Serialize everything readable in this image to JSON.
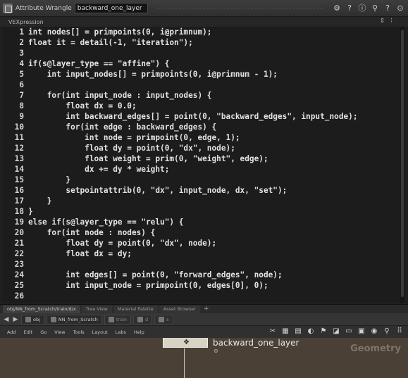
{
  "header": {
    "node_type": "Attribute Wrangle",
    "node_name": "backward_one_layer",
    "icons": [
      "gear-icon",
      "help-icon",
      "info-icon",
      "search-icon",
      "help-icon",
      "pin-icon"
    ]
  },
  "parameter": {
    "label": "VEXpression"
  },
  "code": {
    "lines": [
      {
        "n": "1",
        "text": "int nodes[] = primpoints(0, i@primnum);"
      },
      {
        "n": "2",
        "text": "float it = detail(-1, \"iteration\");"
      },
      {
        "n": "3",
        "text": ""
      },
      {
        "n": "4",
        "text": "if(s@layer_type == \"affine\") {"
      },
      {
        "n": "5",
        "text": "    int input_nodes[] = primpoints(0, i@primnum - 1);"
      },
      {
        "n": "6",
        "text": ""
      },
      {
        "n": "7",
        "text": "    for(int input_node : input_nodes) {"
      },
      {
        "n": "8",
        "text": "        float dx = 0.0;"
      },
      {
        "n": "9",
        "text": "        int backward_edges[] = point(0, \"backward_edges\", input_node);"
      },
      {
        "n": "10",
        "text": "        for(int edge : backward_edges) {"
      },
      {
        "n": "11",
        "text": "            int node = primpoint(0, edge, 1);"
      },
      {
        "n": "12",
        "text": "            float dy = point(0, \"dx\", node);"
      },
      {
        "n": "13",
        "text": "            float weight = prim(0, \"weight\", edge);"
      },
      {
        "n": "14",
        "text": "            dx += dy * weight;"
      },
      {
        "n": "15",
        "text": "        }"
      },
      {
        "n": "16",
        "text": "        setpointattrib(0, \"dx\", input_node, dx, \"set\");"
      },
      {
        "n": "17",
        "text": "    }"
      },
      {
        "n": "18",
        "text": "}"
      },
      {
        "n": "19",
        "text": "else if(s@layer_type == \"relu\") {"
      },
      {
        "n": "20",
        "text": "    for(int node : nodes) {"
      },
      {
        "n": "21",
        "text": "        float dy = point(0, \"dx\", node);"
      },
      {
        "n": "22",
        "text": "        float dx = dy;"
      },
      {
        "n": "23",
        "text": ""
      },
      {
        "n": "24",
        "text": "        int edges[] = point(0, \"forward_edges\", node);"
      },
      {
        "n": "25",
        "text": "        int input_node = primpoint(0, edges[0], 0);"
      },
      {
        "n": "26",
        "text": ""
      }
    ]
  },
  "pane_tabs": [
    {
      "label": "obj/NN_from_Scratch/train/d/x",
      "active": true
    },
    {
      "label": "Tree View",
      "active": false
    },
    {
      "label": "Material Palette",
      "active": false
    },
    {
      "label": "Asset Browser",
      "active": false
    }
  ],
  "path_bar": {
    "crumbs": [
      "obj",
      "NN_from_Scratch",
      "train",
      "d",
      "s"
    ]
  },
  "network_menu": [
    "Add",
    "Edit",
    "Go",
    "View",
    "Tools",
    "Layout",
    "Labs",
    "Help"
  ],
  "network": {
    "node_label": "backward_one_layer",
    "context_label": "Geometry"
  }
}
